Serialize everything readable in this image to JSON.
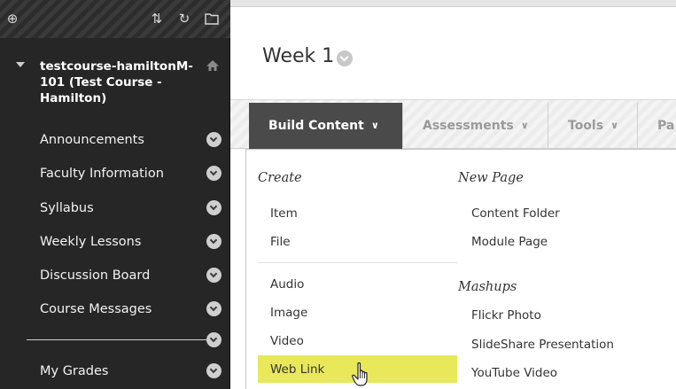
{
  "sidebar": {
    "course_title": "testcourse-hamiltonM-101 (Test Course - Hamilton)",
    "items": [
      {
        "label": "Announcements"
      },
      {
        "label": "Faculty Information"
      },
      {
        "label": "Syllabus"
      },
      {
        "label": "Weekly Lessons"
      },
      {
        "label": "Discussion Board"
      },
      {
        "label": "Course Messages"
      },
      {
        "label": "My Grades"
      }
    ]
  },
  "page": {
    "title": "Week 1"
  },
  "tabs": [
    {
      "label": "Build Content"
    },
    {
      "label": "Assessments"
    },
    {
      "label": "Tools"
    },
    {
      "label": "Pa"
    }
  ],
  "dropdown": {
    "create_heading": "Create",
    "create_items": [
      "Item",
      "File",
      "Audio",
      "Image",
      "Video",
      "Web Link"
    ],
    "newpage_heading": "New Page",
    "newpage_items": [
      "Content Folder",
      "Module Page"
    ],
    "mashups_heading": "Mashups",
    "mashups_items": [
      "Flickr Photo",
      "SlideShare Presentation",
      "YouTube Video"
    ],
    "highlighted_item": "Web Link",
    "highlight_color": "#e8e85a"
  },
  "colors": {
    "sidebar_bg": "#262626",
    "active_tab_bg": "#4a4a4a"
  }
}
